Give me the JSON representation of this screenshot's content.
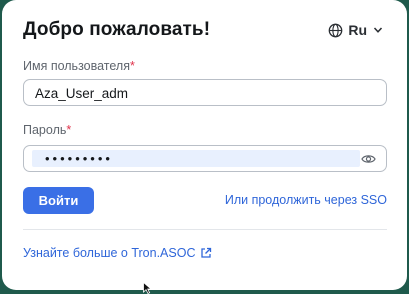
{
  "card": {
    "title": "Добро пожаловать!",
    "language": {
      "label": "Ru",
      "icon": "globe-icon"
    }
  },
  "form": {
    "username": {
      "label": "Имя пользователя",
      "required_mark": "*",
      "value": "Aza_User_adm"
    },
    "password": {
      "label": "Пароль",
      "required_mark": "*",
      "value": "•••••••••",
      "toggle_icon": "eye-icon"
    }
  },
  "actions": {
    "login_label": "Войти",
    "sso_label": "Или продолжить через SSO"
  },
  "footer": {
    "learn_more_label": "Узнайте больше о Tron.ASOC",
    "learn_more_icon": "external-link-icon"
  },
  "colors": {
    "background": "#1f5a4c",
    "primary": "#3a6fe6",
    "link": "#2f66d9",
    "required": "#e0314a"
  }
}
